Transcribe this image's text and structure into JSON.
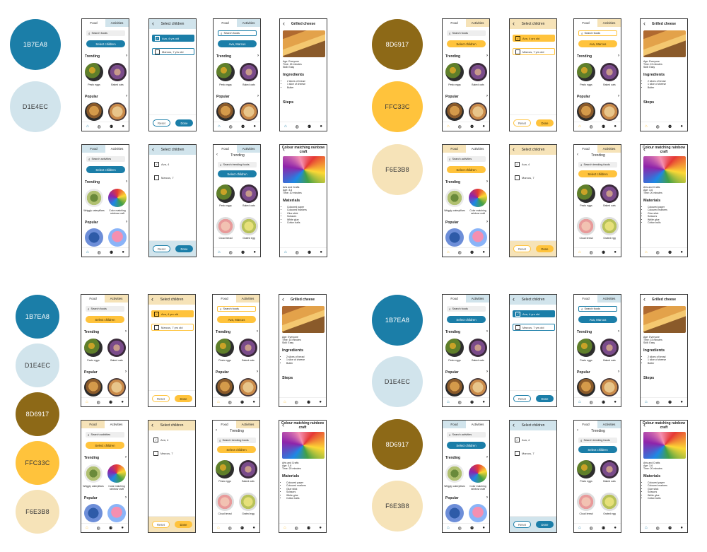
{
  "palettes": {
    "blue": {
      "primary": "#1B7EA8",
      "light": "#D1E4EC",
      "primaryText": "#ffffff",
      "lightText": "#3a3a3a",
      "tabActive": "#D1E4EC"
    },
    "gold": {
      "primary": "#FFC33C",
      "light": "#F6E3B8",
      "primaryText": "#3a2a00",
      "lightText": "#3a2a00",
      "tabActive": "#F6E3B8",
      "brown": "#8D6917"
    }
  },
  "swatches": {
    "tl": [
      {
        "hex": "1B7EA8"
      },
      {
        "hex": "D1E4EC"
      }
    ],
    "tr": [
      {
        "hex": "8D6917"
      },
      {
        "hex": "FFC33C"
      },
      {
        "hex": "F6E3B8"
      }
    ],
    "bl": [
      {
        "hex": "1B7EA8"
      },
      {
        "hex": "D1E4EC"
      },
      {
        "hex": "8D6917"
      },
      {
        "hex": "FFC33C"
      },
      {
        "hex": "F6E3B8"
      }
    ],
    "br": [
      {
        "hex": "1B7EA8"
      },
      {
        "hex": "D1E4EC"
      },
      {
        "hex": "8D6917"
      },
      {
        "hex": "F6E3B8"
      }
    ]
  },
  "screens": {
    "tabs": {
      "food": "Food",
      "activities": "Activities"
    },
    "search_food": "Search foods",
    "search_activities": "Search activities",
    "search_trending": "Search trending foods",
    "select_children": "Select children",
    "trending": "Trending",
    "popular": "Popular",
    "food_items": [
      {
        "label": "Pesto eggs"
      },
      {
        "label": "Baked oats"
      }
    ],
    "trending_more": [
      {
        "label": "Cloud bread"
      },
      {
        "label": "Grated egg"
      }
    ],
    "activity_items": [
      {
        "label": "Wriggly caterpillars"
      },
      {
        "label": "Color matching rainbow craft"
      }
    ],
    "children_full": [
      {
        "label": "Ava, 4 yrs old"
      },
      {
        "label": "Marcus, 7 yrs old"
      }
    ],
    "children_short": [
      {
        "label": "Ava, 4"
      },
      {
        "label": "Marcus, 7"
      }
    ],
    "selected_pill": "Ava, Marcus",
    "reset": "Reset",
    "done": "Done",
    "detail_food": {
      "title": "Grilled cheese",
      "meta": [
        "Age: Everyone",
        "Time: 15 minutes",
        "Skill: Easy"
      ],
      "ingredients_h": "Ingredients",
      "ingredients": [
        "2 slices of bread",
        "1 slice of cheese",
        "Butter"
      ],
      "steps_h": "Steps"
    },
    "detail_craft": {
      "title": "Colour matching rainbow craft",
      "meta": [
        "Arts and Crafts",
        "Age: 3-6",
        "Time: 20 minutes"
      ],
      "materials_h": "Materials",
      "materials": [
        "Coloured paper",
        "Coloured markers",
        "Glue stick",
        "Scissors",
        "White glue",
        "Cotton balls"
      ]
    }
  }
}
